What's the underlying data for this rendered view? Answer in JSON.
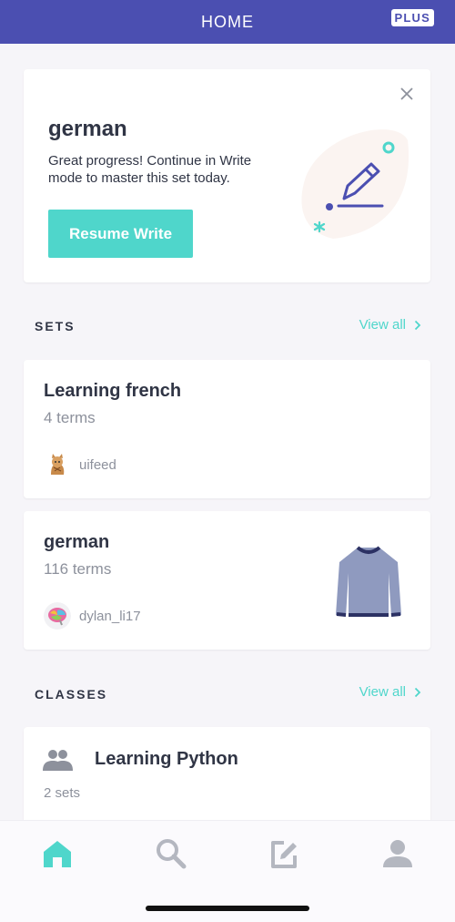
{
  "header": {
    "title": "HOME",
    "plus_badge": "PLUS"
  },
  "colors": {
    "header_bg": "#4b4fb1",
    "accent": "#4fd6cb",
    "text": "#303545",
    "muted": "#8d919c"
  },
  "progress_card": {
    "set_name": "german",
    "message": "Great progress! Continue in Write mode to master this set today.",
    "button_label": "Resume Write",
    "close_icon": "close-icon",
    "illustration": "write-pencil-illustration"
  },
  "sets_section": {
    "title": "SETS",
    "view_all": "View all",
    "items": [
      {
        "title": "Learning french",
        "terms": "4 terms",
        "creator": "uifeed",
        "avatar": "cat-avatar"
      },
      {
        "title": "german",
        "terms": "116 terms",
        "creator": "dylan_li17",
        "avatar": "brain-avatar",
        "thumbnail": "sweater-image"
      }
    ]
  },
  "classes_section": {
    "title": "CLASSES",
    "view_all": "View all",
    "items": [
      {
        "title": "Learning Python",
        "sets": "2 sets",
        "icon": "people-icon"
      }
    ]
  },
  "tabbar": {
    "tabs": [
      {
        "icon": "home-icon",
        "active": true
      },
      {
        "icon": "search-icon",
        "active": false
      },
      {
        "icon": "create-icon",
        "active": false
      },
      {
        "icon": "profile-icon",
        "active": false
      }
    ]
  }
}
